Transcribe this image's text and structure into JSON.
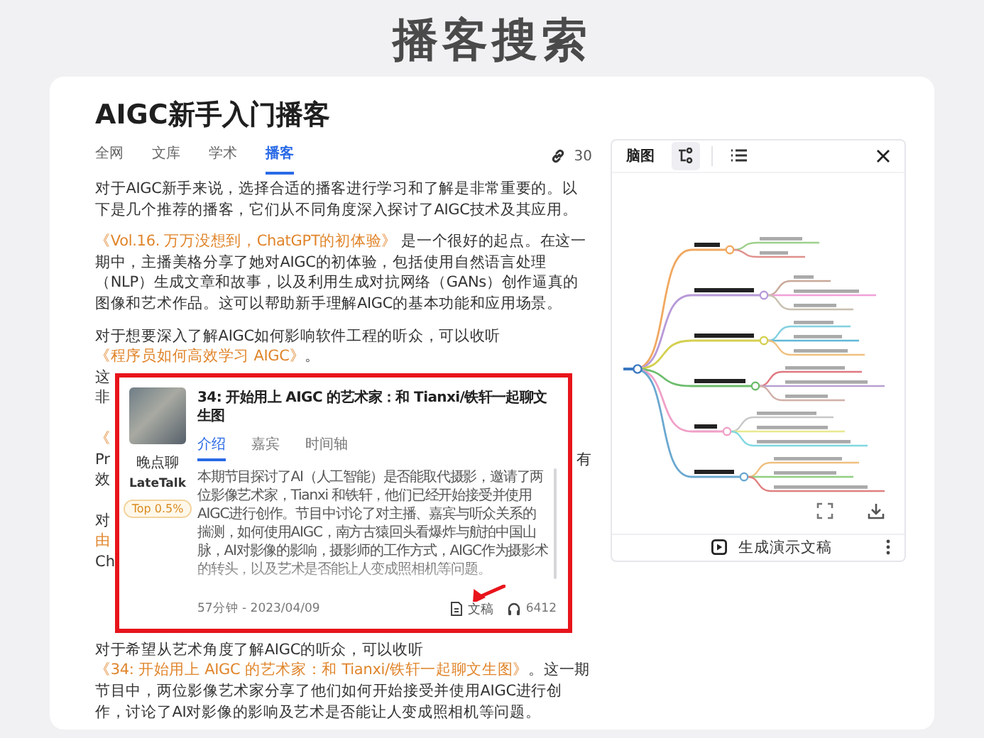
{
  "page_title": "播客搜索",
  "article": {
    "title": "AIGC新手入门播客",
    "tabs": [
      {
        "label": "全网",
        "selected": false
      },
      {
        "label": "文库",
        "selected": false
      },
      {
        "label": "学术",
        "selected": false
      },
      {
        "label": "播客",
        "selected": true
      }
    ],
    "source_count": "30",
    "intro": [
      {
        "segments": [
          {
            "kind": "plain",
            "text": "对于AIGC新手来说，选择合适的播客进行学习和了解是非常重要的。以下是几个推荐的播客，它们从不同角度深入探讨了AIGC技术及其应用。"
          }
        ]
      },
      {
        "segments": [
          {
            "kind": "link",
            "text": "《Vol.16. 万万没想到，ChatGPT的初体验》"
          },
          {
            "kind": "plain",
            "text": " 是一个很好的起点。在这一期中，主播美格分享了她对AIGC的初体验，包括使用自然语言处理（NLP）生成文章和故事，以及利用生成对抗网络（GANs）创作逼真的图像和艺术作品。这可以帮助新手理解AIGC的基本功能和应用场景。"
          }
        ]
      },
      {
        "segments": [
          {
            "kind": "plain",
            "text": "对于想要深入了解AIGC如何影响软件工程的听众，可以收听"
          },
          {
            "kind": "link",
            "text": "《程序员如何高效学习 AIGC》"
          },
          {
            "kind": "plain",
            "text": "。"
          }
        ]
      }
    ],
    "covered_groups": [
      [
        {
          "left": "这",
          "kind": "plain"
        },
        {
          "left": "非",
          "kind": "plain"
        }
      ],
      [
        {
          "left": "《",
          "kind": "link"
        },
        {
          "left": "Pr",
          "right": "有",
          "kind": "plain"
        },
        {
          "left": "效",
          "kind": "plain"
        }
      ],
      [
        {
          "left": "对",
          "kind": "plain"
        },
        {
          "left": "由",
          "kind": "link"
        },
        {
          "left": "Ch",
          "kind": "plain"
        }
      ]
    ],
    "outro": [
      {
        "segments": [
          {
            "kind": "plain",
            "text": "对于希望从艺术角度了解AIGC的听众，可以收听"
          },
          {
            "kind": "link",
            "text": "《34: 开始用上 AIGC 的艺术家：和 Tianxi/铁轩一起聊文生图》"
          },
          {
            "kind": "plain",
            "text": "。这一期节目中，两位影像艺术家分享了他们如何开始接受并使用AIGC进行创作，讨论了AI对影像的影响及艺术是否能让人变成照相机等问题。"
          }
        ]
      }
    ]
  },
  "podcast_card": {
    "show_name": "晚点聊",
    "show_name_en": "LateTalk",
    "rank_badge": "Top 0.5%",
    "title": "34: 开始用上 AIGC 的艺术家：和 Tianxi/铁轩一起聊文生图",
    "tabs": [
      {
        "label": "介绍",
        "selected": true
      },
      {
        "label": "嘉宾",
        "selected": false
      },
      {
        "label": "时间轴",
        "selected": false
      }
    ],
    "description": "本期节目探讨了AI（人工智能）是否能取代摄影，邀请了两位影像艺术家，Tianxi 和铁轩，他们已经开始接受并使用AIGC进行创作。节目中讨论了对主播、嘉宾与听众关系的揣测，如何使用AIGC，南方古猿回头看爆炸与航拍中国山脉，AI对影像的影响，摄影师的工作方式，AIGC作为摄影术的转头，以及艺术是否能让人变成照相机等问题。",
    "meta": "57分钟 - 2023/04/09",
    "transcript_label": "文稿",
    "plays": "6412"
  },
  "mindmap_panel": {
    "title": "脑图",
    "views": [
      {
        "kind": "mindmap",
        "selected": true
      },
      {
        "kind": "list",
        "selected": false
      }
    ],
    "footer_action": "生成演示文稿"
  }
}
